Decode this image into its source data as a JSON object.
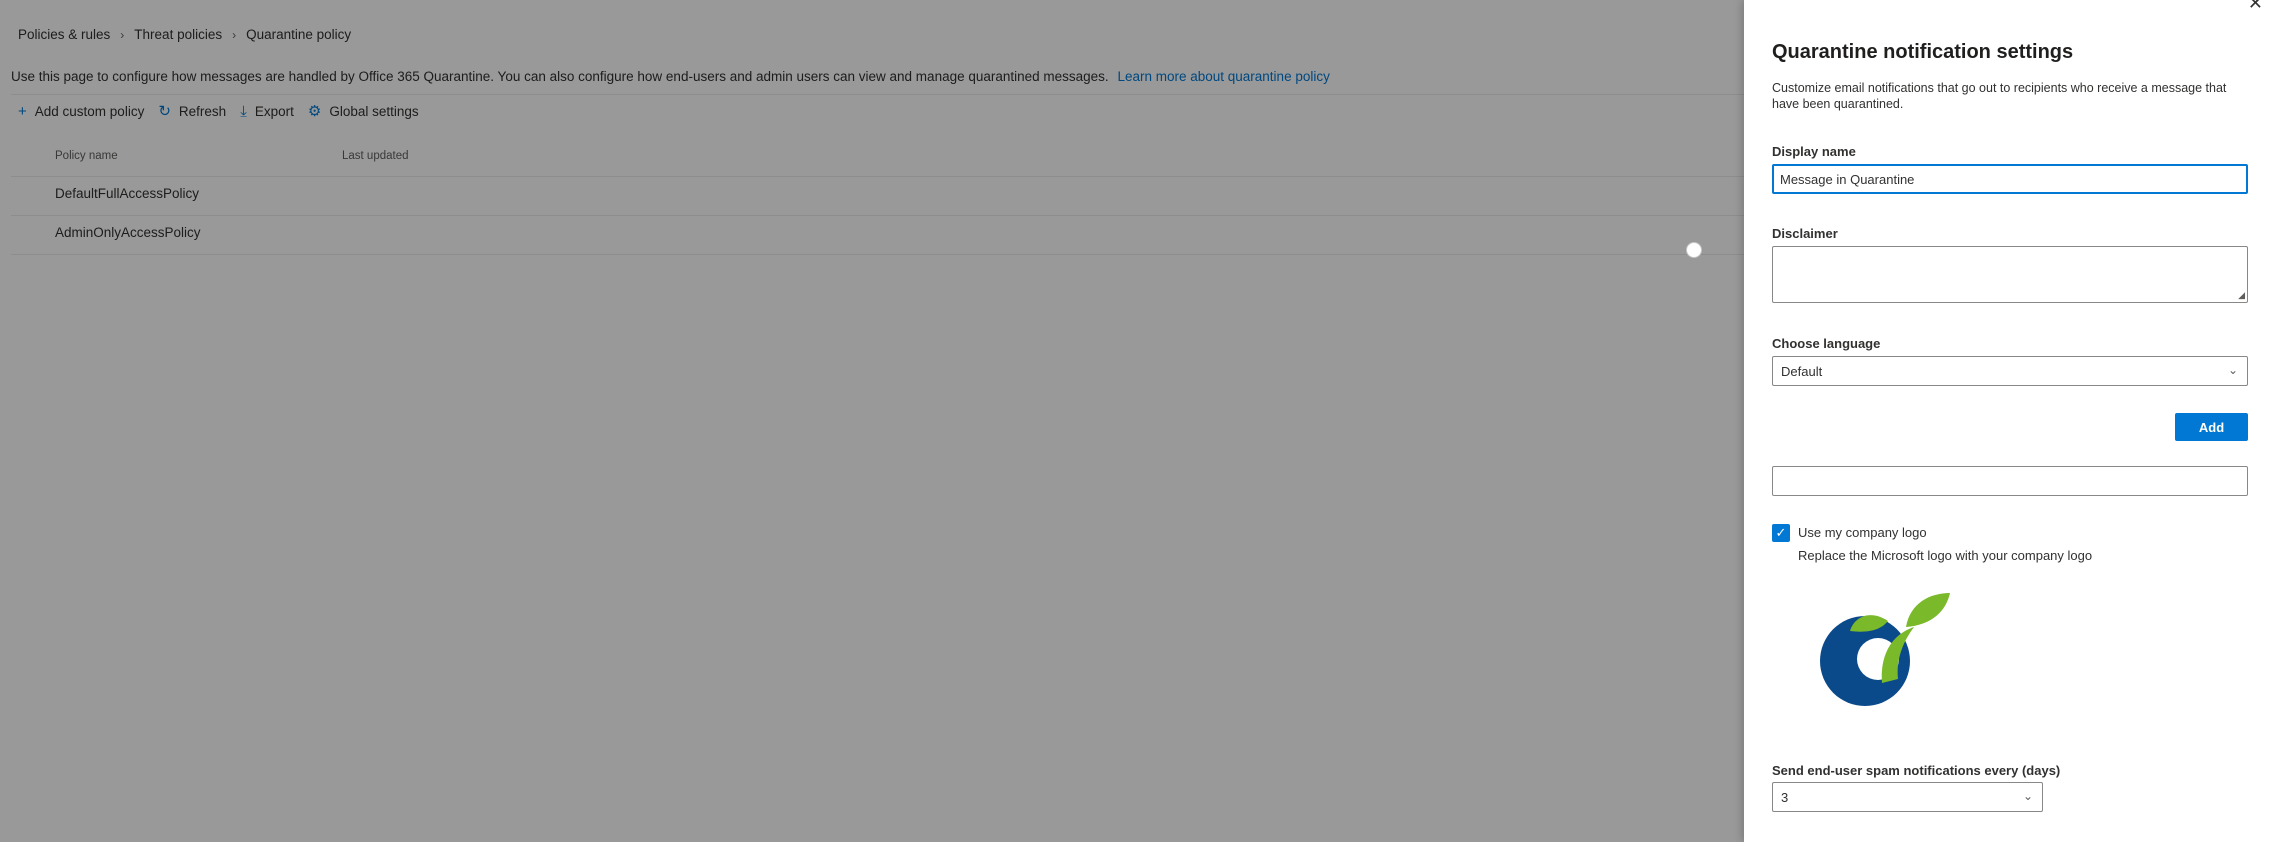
{
  "breadcrumb": {
    "items": [
      "Policies & rules",
      "Threat policies",
      "Quarantine policy"
    ]
  },
  "description": {
    "text": "Use this page to configure how messages are handled by Office 365 Quarantine. You can also configure how end-users and admin users can view and manage quarantined messages.",
    "link": "Learn more about quarantine policy"
  },
  "toolbar": {
    "add_label": "Add custom policy",
    "refresh_label": "Refresh",
    "export_label": "Export",
    "global_label": "Global settings"
  },
  "table": {
    "columns": [
      "Policy name",
      "Last updated"
    ],
    "rows": [
      {
        "name": "DefaultFullAccessPolicy",
        "updated": ""
      },
      {
        "name": "AdminOnlyAccessPolicy",
        "updated": ""
      }
    ]
  },
  "panel": {
    "title": "Quarantine notification settings",
    "description": "Customize email notifications that go out to recipients who receive a message that have been quarantined.",
    "display_name_label": "Display name",
    "display_name_value": "Message in Quarantine",
    "disclaimer_label": "Disclaimer",
    "disclaimer_value": "",
    "language_label": "Choose language",
    "language_value": "Default",
    "add_label": "Add",
    "language_list_value": "",
    "logo_checkbox_label": "Use my company logo",
    "logo_checkbox_checked": true,
    "logo_checkbox_subtext": "Replace the Microsoft logo with your company logo",
    "frequency_label": "Send end-user spam notifications every (days)",
    "frequency_value": "3"
  },
  "icons": {
    "add": "plus-icon",
    "refresh": "refresh-icon",
    "export": "download-icon",
    "global": "gear-icon",
    "close": "close-icon",
    "chevron": "chevron-down-icon",
    "checkmark": "checkmark-icon"
  },
  "colors": {
    "accent": "#0078d4",
    "logo_blue": "#0b4a8a",
    "logo_green": "#7ab929"
  }
}
